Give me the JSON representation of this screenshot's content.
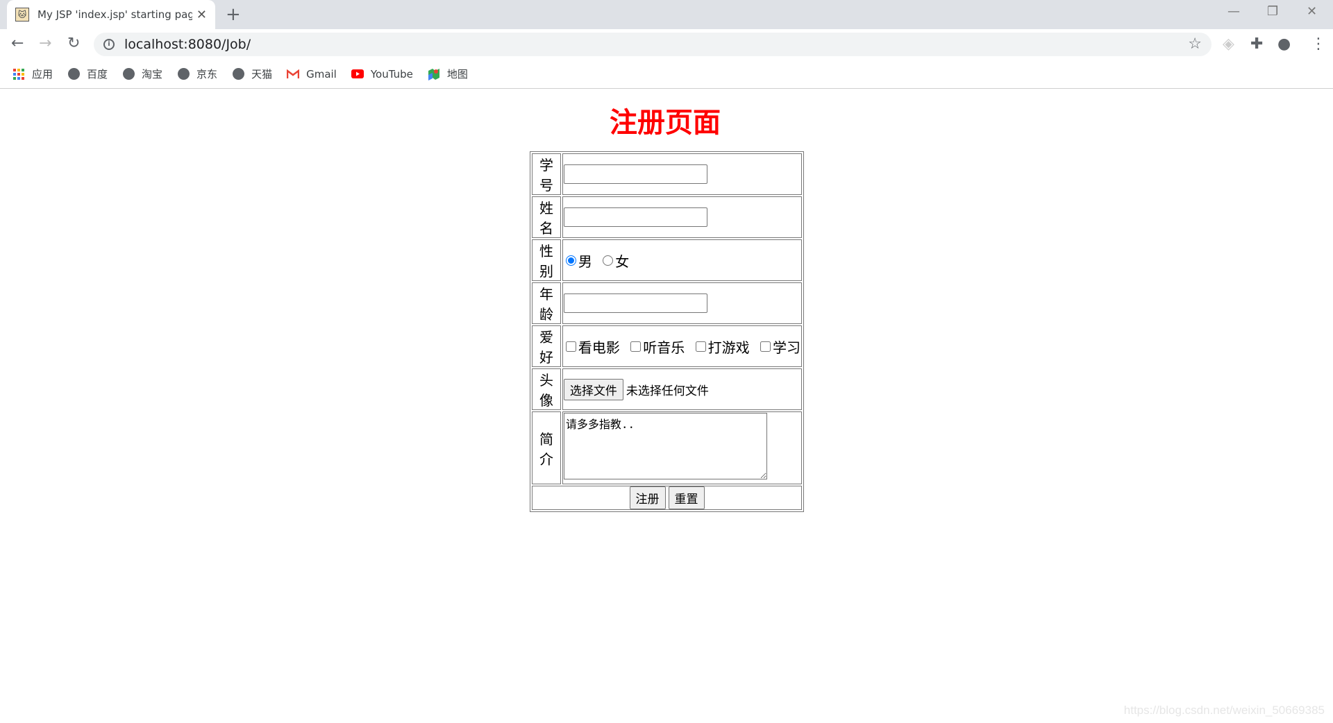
{
  "browser": {
    "tab_title": "My JSP 'index.jsp' starting page",
    "url": "localhost:8080/Job/",
    "bookmarks": [
      {
        "label": "应用",
        "icon": "apps-grid-icon"
      },
      {
        "label": "百度",
        "icon": "globe-icon"
      },
      {
        "label": "淘宝",
        "icon": "globe-icon"
      },
      {
        "label": "京东",
        "icon": "globe-icon"
      },
      {
        "label": "天猫",
        "icon": "globe-icon"
      },
      {
        "label": "Gmail",
        "icon": "gmail-icon"
      },
      {
        "label": "YouTube",
        "icon": "youtube-icon"
      },
      {
        "label": "地图",
        "icon": "maps-icon"
      }
    ]
  },
  "page": {
    "title": "注册页面",
    "title_color": "#ff0000",
    "form": {
      "student_id_label": "学号",
      "name_label": "姓名",
      "gender_label": "性别",
      "gender_options": [
        "男",
        "女"
      ],
      "gender_selected": "男",
      "age_label": "年龄",
      "hobby_label": "爱好",
      "hobbies": [
        "看电影",
        "听音乐",
        "打游戏",
        "学习"
      ],
      "avatar_label": "头像",
      "file_button": "选择文件",
      "file_status": "未选择任何文件",
      "intro_label": "简介",
      "intro_value": "请多多指教..",
      "submit": "注册",
      "reset": "重置"
    }
  },
  "watermark": "https://blog.csdn.net/weixin_50669385"
}
